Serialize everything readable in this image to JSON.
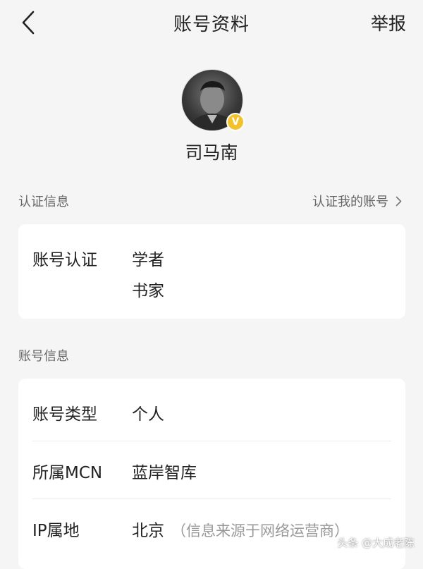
{
  "header": {
    "title": "账号资料",
    "report_label": "举报",
    "back_icon": "chevron-left-icon"
  },
  "profile": {
    "name": "司马南",
    "badge_text": "V",
    "badge_color": "#f2c22c"
  },
  "verification": {
    "section_label": "认证信息",
    "link_label": "认证我的账号",
    "row_label": "账号认证",
    "values": [
      "学者",
      "书家"
    ]
  },
  "account": {
    "section_label": "账号信息",
    "rows": [
      {
        "label": "账号类型",
        "value": "个人",
        "note": ""
      },
      {
        "label": "所属MCN",
        "value": "蓝岸智库",
        "note": ""
      },
      {
        "label": "IP属地",
        "value": "北京",
        "note": "（信息来源于网络运营商）"
      }
    ]
  },
  "watermark": "头条 @大成老陈"
}
